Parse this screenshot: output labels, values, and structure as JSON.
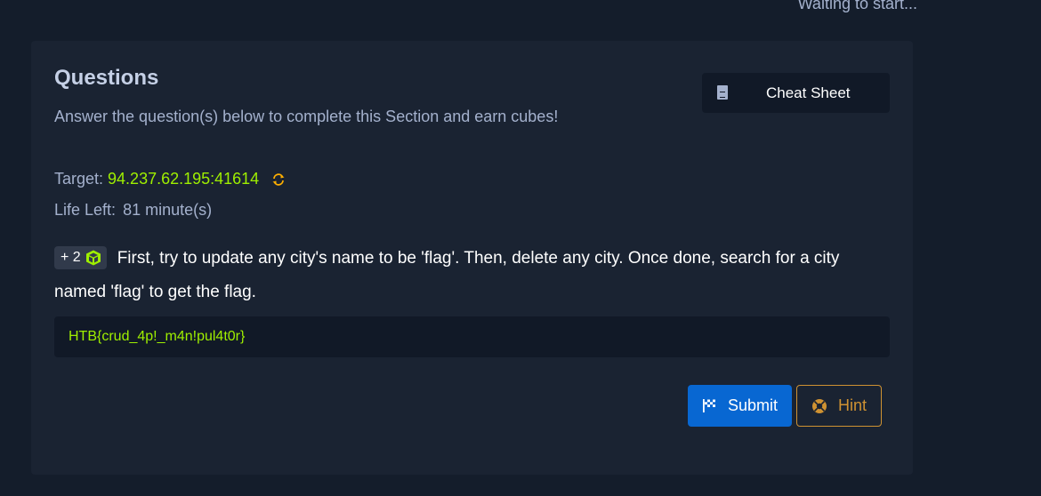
{
  "header": {
    "status": "Waiting to start..."
  },
  "questions": {
    "title": "Questions",
    "subtitle": "Answer the question(s) below to complete this Section and earn cubes!",
    "cheat_sheet_label": "Cheat Sheet",
    "target_label": "Target:",
    "target_value": "94.237.62.195:41614",
    "life_label": "Life Left:",
    "life_value": "81 minute(s)",
    "reward_badge": "+ 2",
    "question_text": "First, try to update any city's name to be 'flag'. Then, delete any city. Once done, search for a city named 'flag' to get the flag.",
    "answer_value": "HTB{crud_4p!_m4n!pul4t0r}",
    "submit_label": "Submit",
    "hint_label": "Hint"
  },
  "icons": {
    "cheat_sheet": "document-icon",
    "refresh": "refresh-icon",
    "cube": "cube-icon",
    "submit": "flag-icon",
    "hint": "hint-icon"
  },
  "colors": {
    "accent_green": "#9fef00",
    "primary_blue": "#0867d2",
    "hint_orange": "#cf9232",
    "card_bg": "#1a2332"
  }
}
